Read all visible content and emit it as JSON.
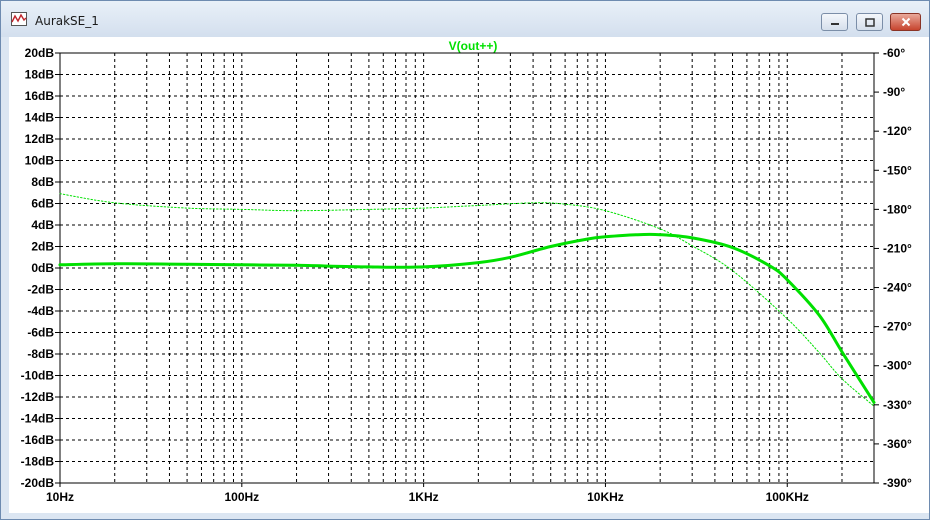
{
  "window": {
    "title": "AurakSE_1",
    "title_icon": "waveform-icon",
    "controls": {
      "minimize_icon": "minimize-icon",
      "maximize_icon": "maximize-icon",
      "close_icon": "close-icon"
    }
  },
  "colors": {
    "trace": "#00e000",
    "grid": "#000000",
    "background": "#ffffff"
  },
  "chart_data": {
    "type": "line",
    "title": "V(out++)",
    "x_scale": "log",
    "xlim": [
      10,
      300000
    ],
    "x_ticks": [
      {
        "value": 10,
        "label": "10Hz"
      },
      {
        "value": 100,
        "label": "100Hz"
      },
      {
        "value": 1000,
        "label": "1KHz"
      },
      {
        "value": 10000,
        "label": "10KHz"
      },
      {
        "value": 100000,
        "label": "100KHz"
      }
    ],
    "y_left": {
      "range": [
        -20,
        20
      ],
      "tick_labels": [
        "20dB",
        "18dB",
        "16dB",
        "14dB",
        "12dB",
        "10dB",
        "8dB",
        "6dB",
        "4dB",
        "2dB",
        "0dB",
        "-2dB",
        "-4dB",
        "-6dB",
        "-8dB",
        "-10dB",
        "-12dB",
        "-14dB",
        "-16dB",
        "-18dB",
        "-20dB"
      ]
    },
    "y_right": {
      "range": [
        -390,
        -60
      ],
      "tick_labels": [
        "-60°",
        "-90°",
        "-120°",
        "-150°",
        "-180°",
        "-210°",
        "-240°",
        "-270°",
        "-300°",
        "-330°",
        "-360°",
        "-390°"
      ]
    },
    "grid": true,
    "series": [
      {
        "axis": "left",
        "style": "solid",
        "x": [
          10,
          20,
          50,
          100,
          200,
          500,
          1000,
          2000,
          3000,
          5000,
          8000,
          10000,
          15000,
          20000,
          30000,
          50000,
          80000,
          100000,
          150000,
          200000,
          300000
        ],
        "y": [
          0.3,
          0.4,
          0.35,
          0.3,
          0.25,
          0.1,
          0.1,
          0.5,
          1.0,
          2.0,
          2.7,
          2.9,
          3.1,
          3.1,
          2.8,
          1.9,
          0.2,
          -1.1,
          -4.4,
          -7.8,
          -12.5
        ]
      },
      {
        "axis": "right",
        "style": "dotted",
        "x": [
          10,
          20,
          50,
          100,
          200,
          500,
          1000,
          2000,
          4000,
          6000,
          10000,
          20000,
          30000,
          50000,
          100000,
          150000,
          200000,
          300000
        ],
        "y": [
          -168,
          -175,
          -179,
          -180,
          -181,
          -180,
          -179,
          -177,
          -175,
          -176,
          -181,
          -195,
          -208,
          -227,
          -264,
          -290,
          -310,
          -331
        ]
      }
    ]
  }
}
